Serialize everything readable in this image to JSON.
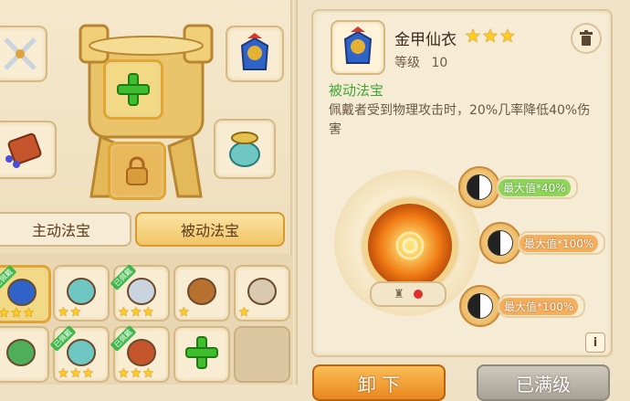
{
  "item": {
    "name": "金甲仙衣",
    "stars": 3,
    "level_label": "等级",
    "level_value": "10",
    "section_title": "被动法宝",
    "description": "佩戴者受到物理攻击时，20%几率降低40%伤害"
  },
  "tabs": {
    "active_label": "主动法宝",
    "passive_label": "被动法宝"
  },
  "attributes": [
    {
      "label": "最大值",
      "value": "*40%"
    },
    {
      "label": "最大值",
      "value": "*100%"
    },
    {
      "label": "最大值",
      "value": "*100%"
    }
  ],
  "inventory": {
    "equipped_tag": "已佩戴",
    "rows": [
      [
        {
          "stars": 3,
          "equipped": true,
          "icon": "armor-icon"
        },
        {
          "stars": 2,
          "equipped": false,
          "icon": "jade-beast-icon"
        },
        {
          "stars": 3,
          "equipped": true,
          "icon": "crossed-swords-icon"
        },
        {
          "stars": 1,
          "equipped": false,
          "icon": "gourd-pouch-icon"
        },
        {
          "stars": 1,
          "equipped": false,
          "icon": "stone-mask-icon"
        }
      ],
      [
        {
          "stars": 0,
          "equipped": false,
          "icon": "jade-dragon-icon"
        },
        {
          "stars": 3,
          "equipped": true,
          "icon": "jade-beast-icon"
        },
        {
          "stars": 3,
          "equipped": true,
          "icon": "scroll-icon"
        },
        {
          "stars": 0,
          "equipped": false,
          "icon": "add-icon"
        },
        {
          "stars": 0,
          "equipped": false,
          "icon": "empty-slot"
        }
      ]
    ]
  },
  "buttons": {
    "unequip": "卸 下",
    "maxed": "已满级"
  },
  "colors": {
    "accent_gold": "#e2a532",
    "add_green": "#3fbf2e",
    "section_green": "#3fa631",
    "maxed_grey": "#b9b2a6"
  }
}
